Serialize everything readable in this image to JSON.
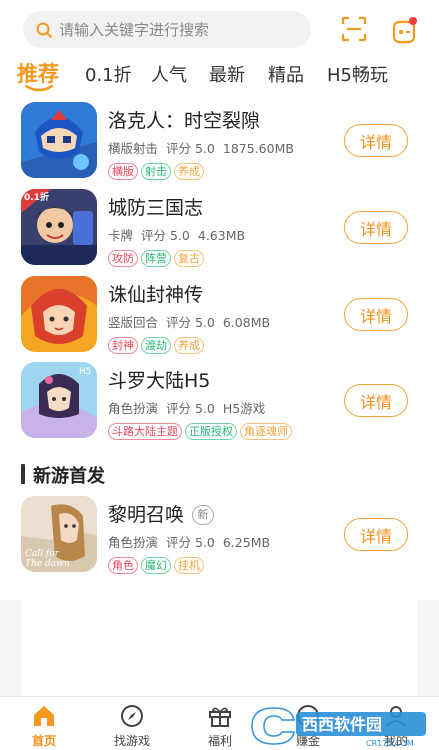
{
  "search": {
    "placeholder": "请输入关键字进行搜索"
  },
  "tabs": [
    "推荐",
    "0.1折",
    "人气",
    "最新",
    "精品",
    "H5畅玩"
  ],
  "games": [
    {
      "name": "洛克人：时空裂隙",
      "category": "横版射击",
      "score": "评分 5.0",
      "size": "1875.60MB",
      "tags": [
        "横版",
        "射击",
        "养成"
      ],
      "button": "详情"
    },
    {
      "name": "城防三国志",
      "category": "卡牌",
      "score": "评分 5.0",
      "size": "4.63MB",
      "tags": [
        "攻防",
        "阵营",
        "复古"
      ],
      "button": "详情"
    },
    {
      "name": "诛仙封神传",
      "category": "竖版回合",
      "score": "评分 5.0",
      "size": "6.08MB",
      "tags": [
        "封神",
        "渡劫",
        "养成"
      ],
      "button": "详情"
    },
    {
      "name": "斗罗大陆H5",
      "category": "角色扮演",
      "score": "评分 5.0",
      "size": "H5游戏",
      "tags": [
        "斗路大陆主题",
        "正版授权",
        "角逐魂师"
      ],
      "button": "详情"
    }
  ],
  "icon_texts": {
    "game2_badge": "0.1折",
    "game4_badge": "H5",
    "game5_line1": "Call for",
    "game5_line2": "The dawn"
  },
  "section": {
    "title": "新游首发"
  },
  "new_game": {
    "name": "黎明召唤",
    "badge": "新",
    "category": "角色扮演",
    "score": "评分 5.0",
    "size": "6.25MB",
    "tags": [
      "角色",
      "魔幻",
      "挂机"
    ],
    "button": "详情"
  },
  "bottom_nav": [
    "首页",
    "找游戏",
    "福利",
    "赚金",
    "我的"
  ],
  "watermark": {
    "brand": "西西软件园",
    "site": "CR173.COM"
  },
  "colors": {
    "accent": "#f39a1e",
    "tag_red": "#e9485c",
    "tag_green": "#27b873",
    "tag_orange": "#f2a23a"
  }
}
